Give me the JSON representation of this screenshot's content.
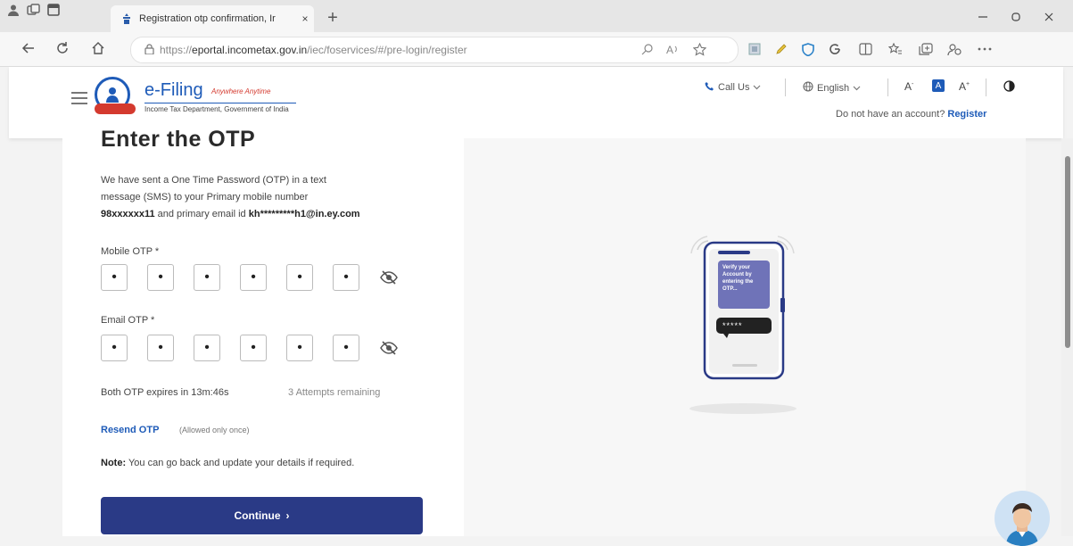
{
  "browser": {
    "tab_title": "Registration otp confirmation, Ir",
    "tab_close": "×",
    "new_tab": "+",
    "url_scheme": "https://",
    "url_host": "eportal.incometax.gov.in",
    "url_path": "/iec/foservices/#/pre-login/register"
  },
  "header": {
    "logo_title": "e-Filing",
    "logo_tagline": "Anywhere Anytime",
    "logo_subtitle": "Income Tax Department, Government of India",
    "call_us": "Call Us",
    "language": "English",
    "font_decrease": "A",
    "font_normal": "A",
    "font_increase": "A",
    "account_prompt": "Do not have an account?",
    "register_link": "Register"
  },
  "otp_form": {
    "title": "Enter the OTP",
    "description_line1": "We have sent a One Time Password (OTP) in a text",
    "description_line2": "message (SMS) to your Primary mobile number",
    "masked_mobile": "98xxxxxx11",
    "description_mid": " and primary email id ",
    "masked_email": "kh*********h1@in.ey.com",
    "mobile_label": "Mobile OTP *",
    "email_label": "Email OTP *",
    "otp_digits": [
      "•",
      "•",
      "•",
      "•",
      "•",
      "•"
    ],
    "expiry_text": "Both OTP expires in 13m:46s",
    "attempts_text": "3 Attempts remaining",
    "resend_label": "Resend OTP",
    "resend_note": "(Allowed only once)",
    "note_label": "Note:",
    "note_text": " You can go back and update your details if required.",
    "continue_label": "Continue",
    "continue_arrow": "›"
  },
  "illustration": {
    "message_text": "Verify your Account by entering the OTP...",
    "masked_code": "*****"
  },
  "colors": {
    "primary": "#2a3a86",
    "link": "#1e5bb8",
    "phone_card": "#6f73b8"
  }
}
